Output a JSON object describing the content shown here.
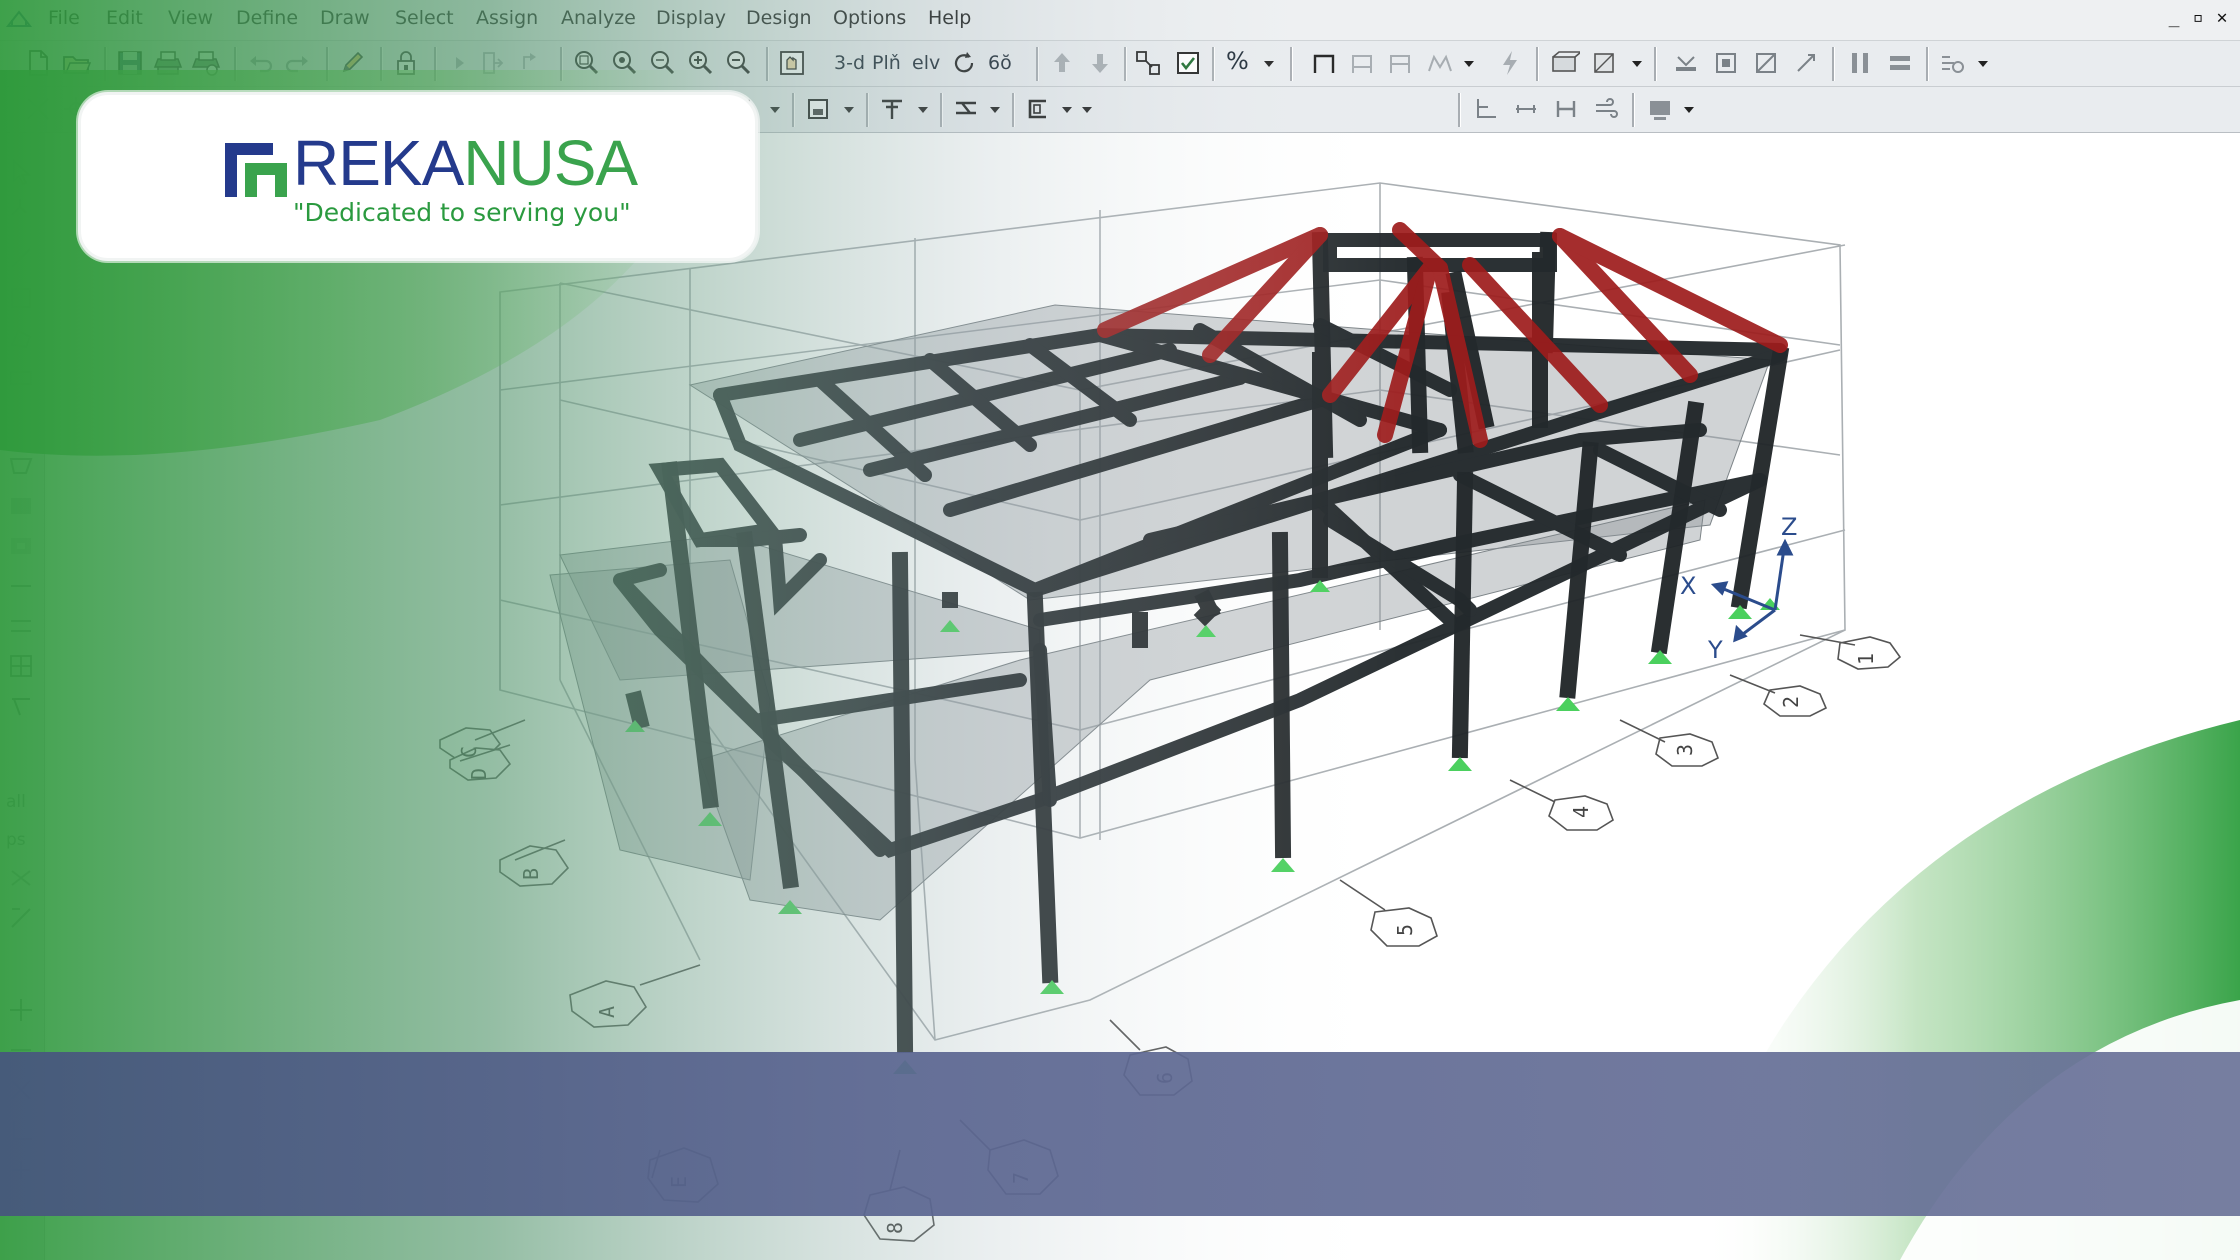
{
  "app": {
    "menu": [
      "File",
      "Edit",
      "View",
      "Define",
      "Draw",
      "Select",
      "Assign",
      "Analyze",
      "Display",
      "Design",
      "Options",
      "Help"
    ],
    "window_controls": [
      "_",
      "▫",
      "✕"
    ]
  },
  "toolbar1": {
    "view_3d_label": "3-d",
    "view_plan_label": "Plň",
    "view_elev_label": "elv",
    "view_perspective_label": "6ŏ",
    "percent_label": "%"
  },
  "left_toolbar": {
    "all_label": "all",
    "ps_label": "ps"
  },
  "viewport": {
    "axes": {
      "x": "X",
      "y": "Y",
      "z": "Z"
    },
    "grid_numbers": [
      "1",
      "2",
      "3",
      "4",
      "5",
      "6",
      "7",
      "8"
    ],
    "grid_letters": [
      "A",
      "B",
      "C",
      "D",
      "E"
    ]
  },
  "brand": {
    "name_part1": "REKA",
    "name_part2": "NUSA",
    "tagline": "\"Dedicated to serving you\"",
    "color_blue": "#243a8c",
    "color_green": "#3aa34d"
  },
  "colors": {
    "frame_members": "#2b3134",
    "roof_members": "#a31f1f",
    "slabs": "#9aa0a3",
    "supports": "#49c95a",
    "banner": "#56618a"
  }
}
